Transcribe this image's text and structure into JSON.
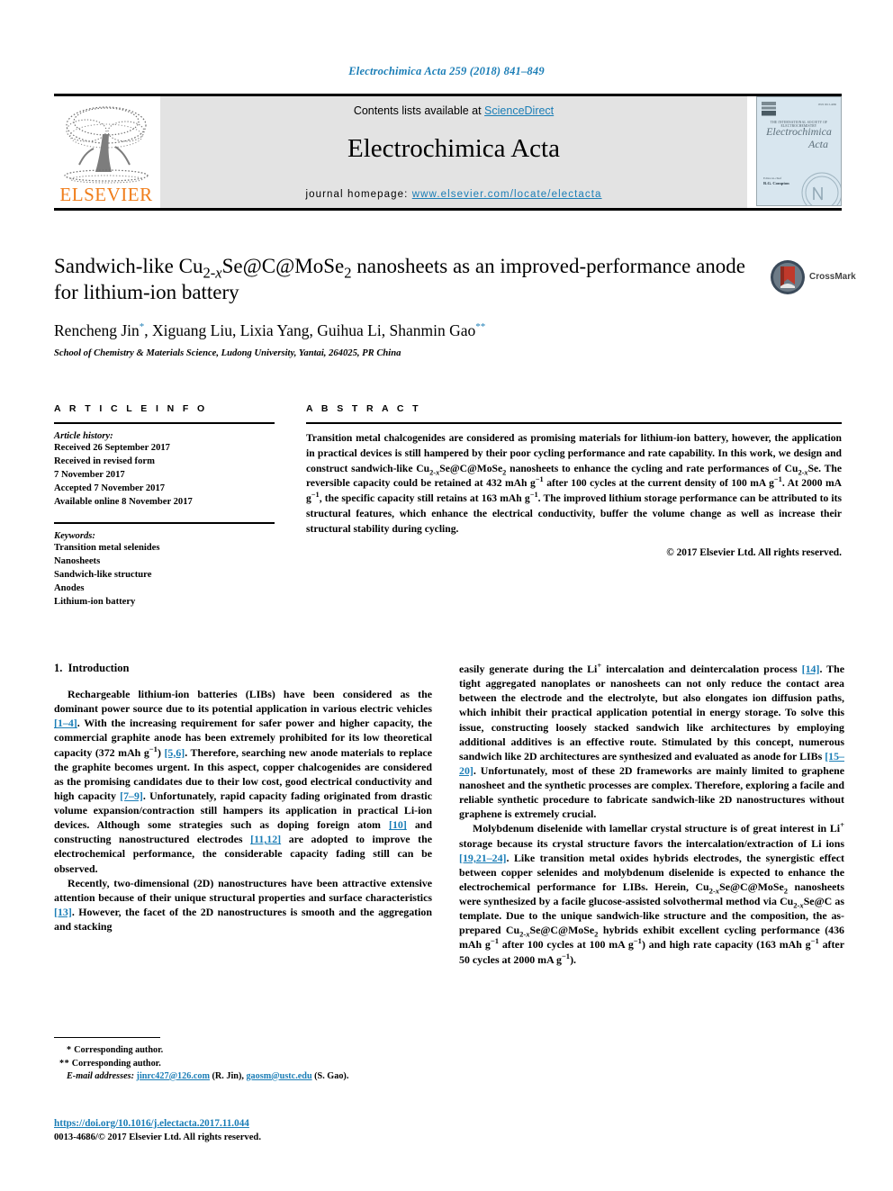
{
  "running_head": "Electrochimica Acta 259 (2018) 841–849",
  "masthead": {
    "contents_prefix": "Contents lists available at ",
    "sciencedirect": "ScienceDirect",
    "journal_title": "Electrochimica Acta",
    "homepage_label": "journal homepage: ",
    "homepage_url": "www.elsevier.com/locate/electacta",
    "publisher_wordmark": "ELSEVIER",
    "cover": {
      "subtitle": "THE INTERNATIONAL SOCIETY OF ELECTROCHEMISTRY",
      "name_line1": "Electrochimica",
      "name_line2": "Acta",
      "editor_label": "Editor-in-chief",
      "editor_name": "R.G. Compton",
      "issn_note": "ISSN 0013-4686"
    },
    "accent_link_color": "#1a7db6",
    "panel_color": "#e3e3e3"
  },
  "article": {
    "title": "Sandwich-like Cu2-xSe@C@MoSe2 nanosheets as an improved-performance anode for lithium-ion battery",
    "authors": "Rencheng Jin, Xiguang Liu, Lixia Yang, Guihua Li, Shanmin Gao",
    "affiliation": "School of Chemistry & Materials Science, Ludong University, Yantai, 264025, PR China",
    "crossmark_label": "CrossMark"
  },
  "info": {
    "heading": "A R T I C L E   I N F O",
    "history_label": "Article history:",
    "history": [
      "Received 26 September 2017",
      "Received in revised form",
      "7 November 2017",
      "Accepted 7 November 2017",
      "Available online 8 November 2017"
    ],
    "keywords_label": "Keywords:",
    "keywords": [
      "Transition metal selenides",
      "Nanosheets",
      "Sandwich-like structure",
      "Anodes",
      "Lithium-ion battery"
    ]
  },
  "abstract": {
    "heading": "A B S T R A C T",
    "copyright": "© 2017 Elsevier Ltd. All rights reserved."
  },
  "body": {
    "section1_number": "1.",
    "section1_title": "Introduction"
  },
  "footnotes": {
    "corresponding1": "Corresponding author.",
    "corresponding2": "Corresponding author.",
    "email_label": "E-mail addresses:",
    "email1": "jinrc427@126.com",
    "email1_owner": "(R. Jin),",
    "email2": "gaosm@ustc.edu",
    "email2_owner": "(S. Gao).",
    "doi": "https://doi.org/10.1016/j.electacta.2017.11.044",
    "issn_line": "0013-4686/© 2017 Elsevier Ltd. All rights reserved."
  }
}
